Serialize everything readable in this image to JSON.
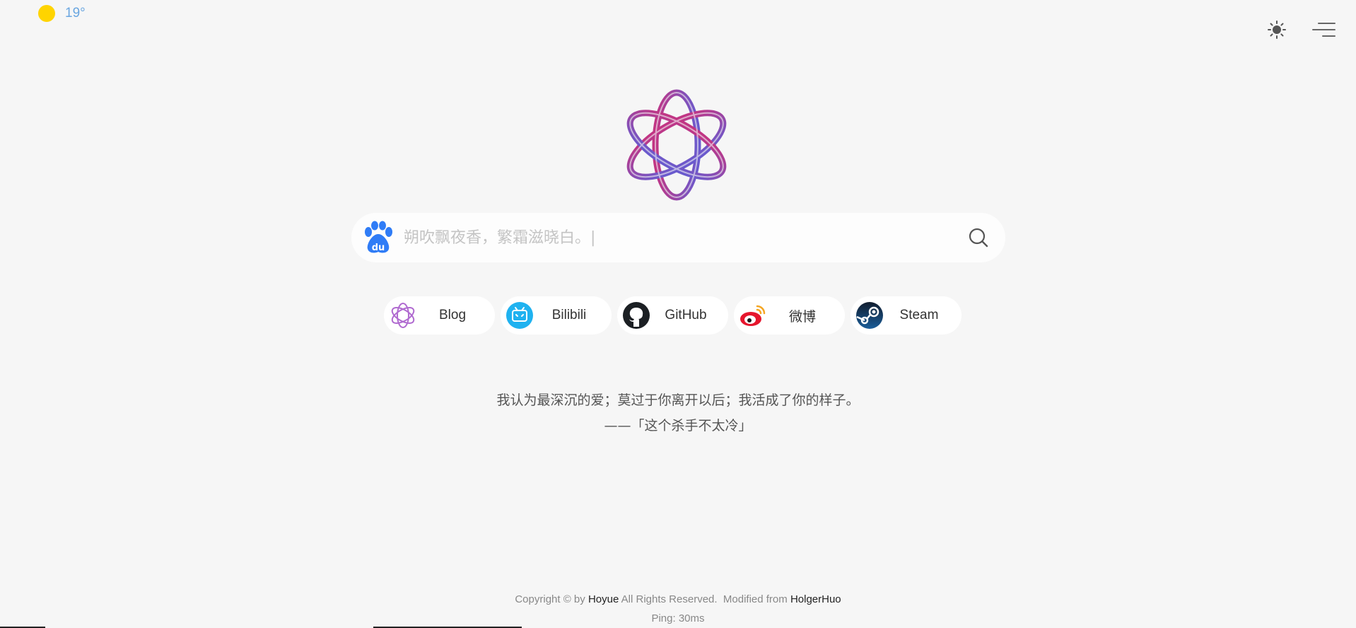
{
  "weather": {
    "temperature": "19°",
    "icon": "sun-icon"
  },
  "header": {
    "theme_icon": "brightness-icon",
    "menu_icon": "menu-icon"
  },
  "search": {
    "engine_icon": "baidu-icon",
    "placeholder": "朔吹飘夜香，繁霜滋晓白。|",
    "value": "",
    "submit_icon": "search-icon"
  },
  "links": [
    {
      "label": "Blog",
      "icon": "blog-logo-icon"
    },
    {
      "label": "Bilibili",
      "icon": "bilibili-icon"
    },
    {
      "label": "GitHub",
      "icon": "github-icon"
    },
    {
      "label": "微博",
      "icon": "weibo-icon"
    },
    {
      "label": "Steam",
      "icon": "steam-icon"
    }
  ],
  "quote": {
    "text": "我认为最深沉的爱；莫过于你离开以后；我活成了你的样子。",
    "source": "——「这个杀手不太冷」"
  },
  "footer": {
    "copyright_prefix": "Copyright © by",
    "author": "Hoyue",
    "rights": "All Rights Reserved.",
    "modified_from": "Modified from",
    "original_author": "HolgerHuo",
    "ping": "Ping: 30ms"
  },
  "colors": {
    "background": "#f6f6f6",
    "sun": "#ffd400",
    "temperature": "#6aa6e0",
    "baidu": "#2f7cf6",
    "bilibili": "#1fb2f0",
    "weibo": "#e6162d",
    "steam": "#1b2838",
    "logo_start": "#c13584",
    "logo_end": "#6a5acd"
  }
}
